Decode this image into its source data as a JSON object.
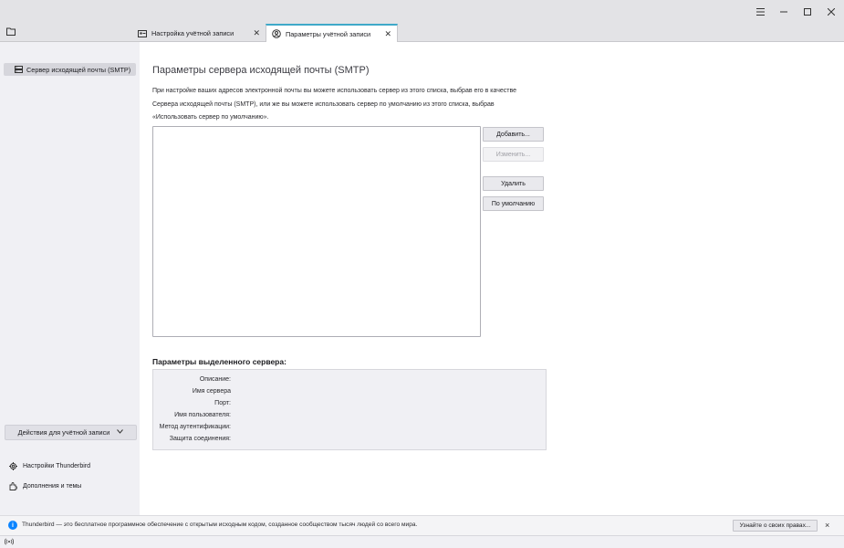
{
  "window": {
    "menu_icon": "hamburger-menu-icon",
    "minimize_icon": "minimize-icon",
    "maximize_icon": "maximize-icon",
    "close_icon": "close-icon"
  },
  "tabs": [
    {
      "label": "Настройка учётной записи",
      "icon": "account-settings-icon",
      "active": false
    },
    {
      "label": "Параметры учётной записи",
      "icon": "account-icon",
      "active": true
    }
  ],
  "sidebar": {
    "items": [
      {
        "label": "Сервер исходящей почты (SMTP)",
        "icon": "outgoing-server-icon",
        "selected": true
      }
    ],
    "actions_label": "Действия для учётной записи",
    "links": [
      {
        "label": "Настройки Thunderbird",
        "icon": "gear-icon"
      },
      {
        "label": "Дополнения и темы",
        "icon": "puzzle-icon"
      }
    ]
  },
  "main": {
    "title": "Параметры сервера исходящей почты (SMTP)",
    "description_lines": [
      "При настройке ваших адресов электронной почты вы можете использовать сервер из этого списка, выбрав его в качестве",
      "Сервера исходящей почты (SMTP), или же вы можете использовать сервер по умолчанию из этого списка, выбрав",
      "«Использовать сервер по умолчанию»."
    ],
    "buttons": {
      "add": "Добавить...",
      "edit": "Изменить...",
      "remove": "Удалить",
      "default": "По умолчанию"
    },
    "details_title": "Параметры выделенного сервера:",
    "details_labels": [
      "Описание:",
      "Имя сервера",
      "Порт:",
      "Имя пользователя:",
      "Метод аутентификации:",
      "Защита соединения:"
    ]
  },
  "notification": {
    "text": "Thunderbird — это бесплатное программное обеспечение с открытым исходным кодом, созданное сообществом тысяч людей со всего мира.",
    "button": "Узнайте о своих правах...",
    "close": "×"
  },
  "colors": {
    "accent": "#3fa9c9",
    "info": "#0a84ff"
  }
}
